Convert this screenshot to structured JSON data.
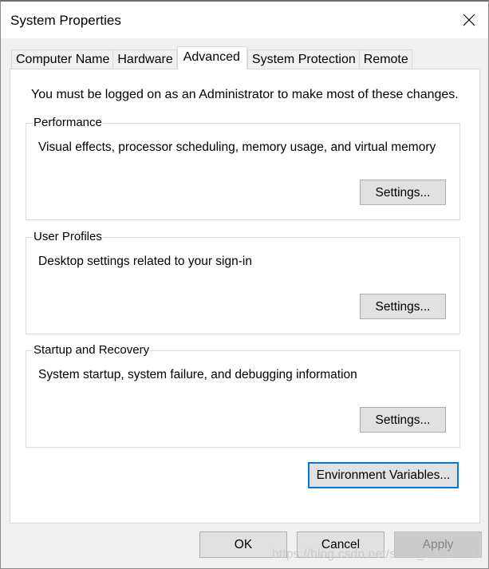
{
  "window": {
    "title": "System Properties",
    "close_icon": "close-icon"
  },
  "tabs": [
    {
      "label": "Computer Name",
      "active": false
    },
    {
      "label": "Hardware",
      "active": false
    },
    {
      "label": "Advanced",
      "active": true
    },
    {
      "label": "System Protection",
      "active": false
    },
    {
      "label": "Remote",
      "active": false
    }
  ],
  "advanced": {
    "admin_note": "You must be logged on as an Administrator to make most of these changes.",
    "groups": [
      {
        "label": "Performance",
        "description": "Visual effects, processor scheduling, memory usage, and virtual memory",
        "button": "Settings..."
      },
      {
        "label": "User Profiles",
        "description": "Desktop settings related to your sign-in",
        "button": "Settings..."
      },
      {
        "label": "Startup and Recovery",
        "description": "System startup, system failure, and debugging information",
        "button": "Settings..."
      }
    ],
    "env_button": "Environment Variables..."
  },
  "footer": {
    "ok": "OK",
    "cancel": "Cancel",
    "apply": "Apply",
    "apply_enabled": false
  },
  "watermark": "https://blog.csdn.net/sinat_36955332",
  "colors": {
    "focus_border": "#0078d7",
    "dialog_bg": "#f0f0f0",
    "panel_bg": "#ffffff"
  }
}
